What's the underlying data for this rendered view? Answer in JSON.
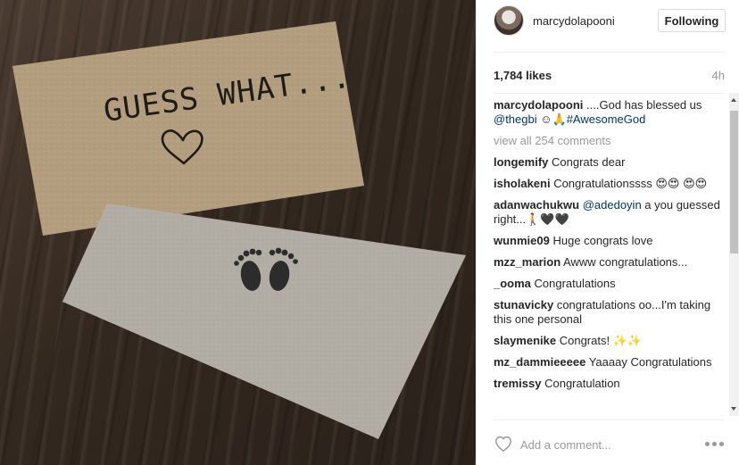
{
  "post": {
    "username": "marcydolapooni",
    "follow_label": "Following",
    "likes": "1,784 likes",
    "time": "4h",
    "photo_text": {
      "headline": "GUESS WHAT..."
    }
  },
  "comments": {
    "caption": {
      "user": "marcydolapooni",
      "text": " ....God has blessed us ",
      "mention": "@thegbi",
      "emoji": " ☺🙏",
      "hashtag": "#AwesomeGod"
    },
    "view_all": "view all 254 comments",
    "items": [
      {
        "user": "longemify",
        "text": " Congrats dear"
      },
      {
        "user": "isholakeni",
        "text": " Congratulationssss 😍😍 😍😍"
      },
      {
        "user": "adanwachukwu",
        "mention": "@adedoyin",
        "text": "  a you guessed right...🚶🖤🖤"
      },
      {
        "user": "wunmie09",
        "text": " Huge congrats love"
      },
      {
        "user": "mzz_marion",
        "text": " Awww congratulations..."
      },
      {
        "user": "_ooma",
        "text": " Congratulations"
      },
      {
        "user": "stunavicky",
        "text": " congratulations oo...I'm taking this one personal"
      },
      {
        "user": "slaymenike",
        "text": " Congrats! ✨✨"
      },
      {
        "user": "mz_dammieeeee",
        "text": " Yaaaay Congratulations"
      },
      {
        "user": "tremissy",
        "text": " Congratulation"
      }
    ]
  },
  "footer": {
    "comment_placeholder": "Add a comment..."
  },
  "icons": {
    "like": "heart-outline-icon",
    "more": "ellipsis-icon",
    "footprints": "baby-feet-icon"
  },
  "colors": {
    "link": "#003569",
    "muted": "#999999",
    "text": "#262626",
    "card_kraft": "#b8a58a",
    "card_grey": "#b3afa8"
  }
}
